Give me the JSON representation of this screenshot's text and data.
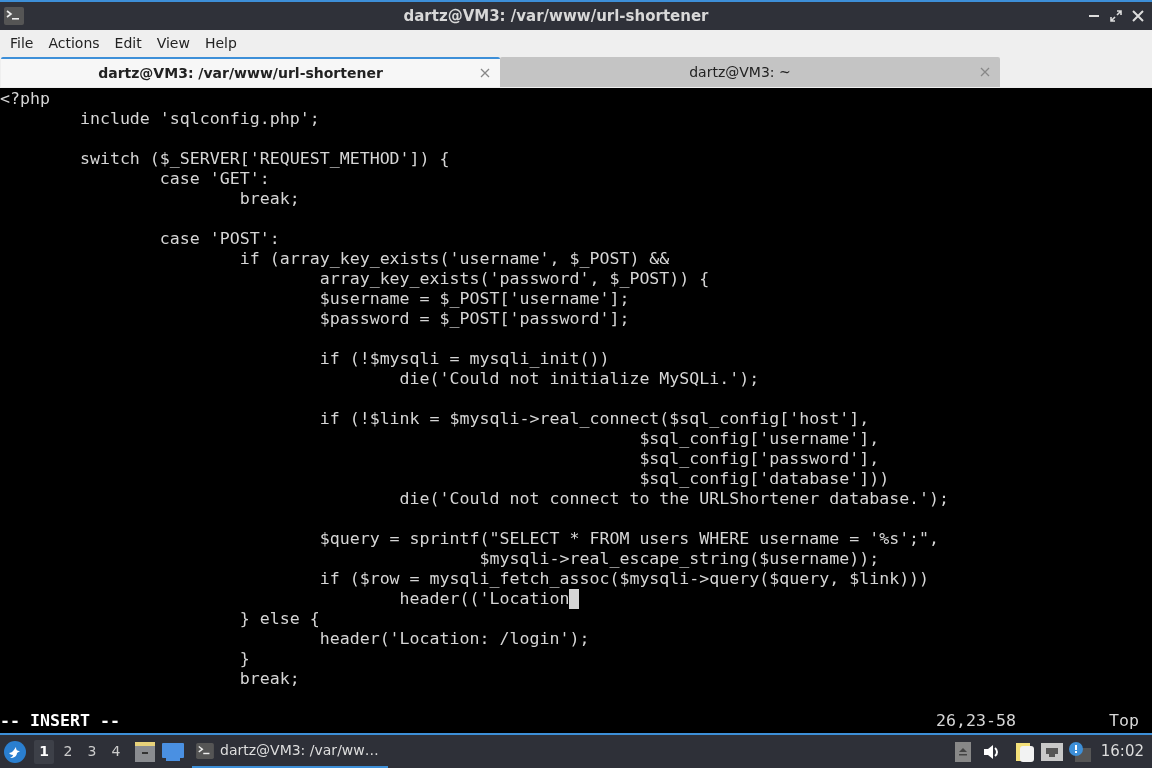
{
  "window": {
    "title": "dartz@VM3: /var/www/url-shortener"
  },
  "menu": [
    "File",
    "Actions",
    "Edit",
    "View",
    "Help"
  ],
  "tabs": [
    {
      "label": "dartz@VM3: /var/www/url-shortener",
      "selected": true
    },
    {
      "label": "dartz@VM3: ~",
      "selected": false
    }
  ],
  "editor": {
    "blocks": [
      [
        {
          "text": "<?php",
          "cursor": false
        },
        {
          "text": "        include 'sqlconfig.php';",
          "cursor": false
        }
      ],
      [
        {
          "text": "        switch ($_SERVER['REQUEST_METHOD']) {",
          "cursor": false
        },
        {
          "text": "                case 'GET':",
          "cursor": false
        },
        {
          "text": "                        break;",
          "cursor": false
        }
      ],
      [
        {
          "text": "                case 'POST':",
          "cursor": false
        },
        {
          "text": "                        if (array_key_exists('username', $_POST) &&",
          "cursor": false
        },
        {
          "text": "                                array_key_exists('password', $_POST)) {",
          "cursor": false
        },
        {
          "text": "                                $username = $_POST['username'];",
          "cursor": false
        },
        {
          "text": "                                $password = $_POST['password'];",
          "cursor": false
        }
      ],
      [
        {
          "text": "                                if (!$mysqli = mysqli_init())",
          "cursor": false
        },
        {
          "text": "                                        die('Could not initialize MySQLi.');",
          "cursor": false
        }
      ],
      [
        {
          "text": "                                if (!$link = $mysqli->real_connect($sql_config['host'],",
          "cursor": false
        },
        {
          "text": "                                                                $sql_config['username'],",
          "cursor": false
        },
        {
          "text": "                                                                $sql_config['password'],",
          "cursor": false
        },
        {
          "text": "                                                                $sql_config['database']))",
          "cursor": false
        },
        {
          "text": "                                        die('Could not connect to the URLShortener database.');",
          "cursor": false
        }
      ],
      [
        {
          "text": "                                $query = sprintf(\"SELECT * FROM users WHERE username = '%s';\",",
          "cursor": false
        },
        {
          "text": "                                                $mysqli->real_escape_string($username));",
          "cursor": false
        },
        {
          "text": "                                if ($row = mysqli_fetch_assoc($mysqli->query($query, $link)))",
          "cursor": false
        },
        {
          "text": "                                        header(('Location",
          "cursor": true
        },
        {
          "text": "                        } else {",
          "cursor": false
        },
        {
          "text": "                                header('Location: /login');",
          "cursor": false
        },
        {
          "text": "                        }",
          "cursor": false
        },
        {
          "text": "                        break;",
          "cursor": false
        }
      ]
    ],
    "mode": "-- INSERT --",
    "position": "26,23-58",
    "scroll": "Top"
  },
  "taskbar": {
    "workspaces": [
      {
        "label": "1",
        "selected": true
      },
      {
        "label": "2",
        "selected": false
      },
      {
        "label": "3",
        "selected": false
      },
      {
        "label": "4",
        "selected": false
      }
    ],
    "tasks": [
      {
        "label": "dartz@VM3: /var/ww…",
        "selected": true
      }
    ],
    "clock": "16:02"
  }
}
